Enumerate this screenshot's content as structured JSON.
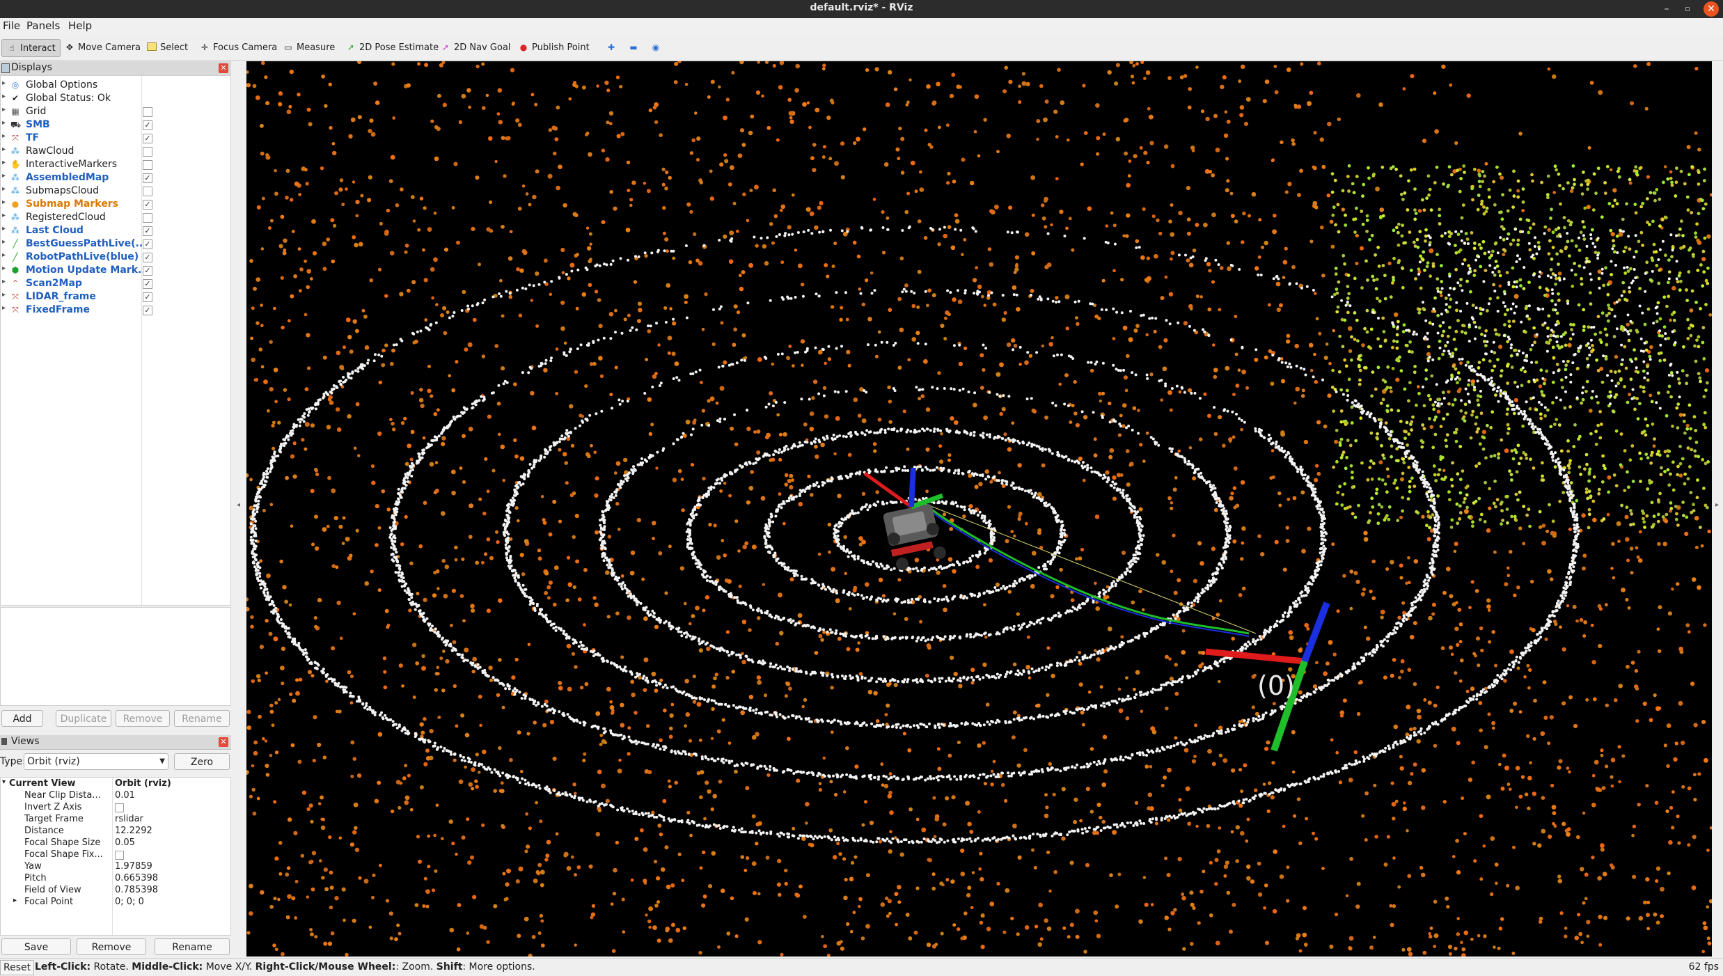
{
  "window": {
    "title": "default.rviz* - RViz"
  },
  "menu": [
    "File",
    "Panels",
    "Help"
  ],
  "toolbar": [
    {
      "label": "Interact",
      "icon": "hand-cursor-icon"
    },
    {
      "label": "Move Camera",
      "icon": "move-camera-icon"
    },
    {
      "label": "Select",
      "icon": "select-box-icon"
    },
    {
      "label": "Focus Camera",
      "icon": "focus-camera-icon"
    },
    {
      "label": "Measure",
      "icon": "ruler-icon"
    },
    {
      "label": "2D Pose Estimate",
      "icon": "green-arrow-icon"
    },
    {
      "label": "2D Nav Goal",
      "icon": "pink-arrow-icon"
    },
    {
      "label": "Publish Point",
      "icon": "map-pin-icon"
    }
  ],
  "displays": {
    "title": "Displays",
    "items": [
      {
        "label": "Global Options",
        "style": "plain",
        "checked": null
      },
      {
        "label": "Global Status: Ok",
        "style": "plain",
        "checked": null
      },
      {
        "label": "Grid",
        "style": "plain",
        "checked": false
      },
      {
        "label": "SMB",
        "style": "blue",
        "checked": true
      },
      {
        "label": "TF",
        "style": "blue",
        "checked": true
      },
      {
        "label": "RawCloud",
        "style": "plain",
        "checked": false
      },
      {
        "label": "InteractiveMarkers",
        "style": "plain",
        "checked": false
      },
      {
        "label": "AssembledMap",
        "style": "blue",
        "checked": true
      },
      {
        "label": "SubmapsCloud",
        "style": "plain",
        "checked": false
      },
      {
        "label": "Submap Markers",
        "style": "orange",
        "checked": true
      },
      {
        "label": "RegisteredCloud",
        "style": "plain",
        "checked": false
      },
      {
        "label": "Last Cloud",
        "style": "blue",
        "checked": true
      },
      {
        "label": "BestGuessPathLive(...",
        "style": "blue",
        "checked": true
      },
      {
        "label": "RobotPathLive(blue)",
        "style": "blue",
        "checked": true
      },
      {
        "label": "Motion Update Mark...",
        "style": "blue",
        "checked": true
      },
      {
        "label": "Scan2Map",
        "style": "blue",
        "checked": true
      },
      {
        "label": "LIDAR_frame",
        "style": "blue",
        "checked": true
      },
      {
        "label": "FixedFrame",
        "style": "blue",
        "checked": true
      }
    ],
    "buttons": {
      "add": "Add",
      "duplicate": "Duplicate",
      "remove": "Remove",
      "rename": "Rename"
    }
  },
  "views": {
    "title": "Views",
    "type_label": "Type:",
    "type_value": "Orbit (rviz)",
    "zero": "Zero",
    "current_view": "Current View",
    "current_view_value": "Orbit (rviz)",
    "props": [
      {
        "key": "Near Clip Dista...",
        "value": "0.01"
      },
      {
        "key": "Invert Z Axis",
        "value": ""
      },
      {
        "key": "Target Frame",
        "value": "rslidar"
      },
      {
        "key": "Distance",
        "value": "12.2292"
      },
      {
        "key": "Focal Shape Size",
        "value": "0.05"
      },
      {
        "key": "Focal Shape Fix...",
        "value": ""
      },
      {
        "key": "Yaw",
        "value": "1.97859"
      },
      {
        "key": "Pitch",
        "value": "0.665398"
      },
      {
        "key": "Field of View",
        "value": "0.785398"
      },
      {
        "key": "Focal Point",
        "value": "0; 0; 0"
      }
    ],
    "buttons": {
      "save": "Save",
      "remove": "Remove",
      "rename": "Rename"
    }
  },
  "viewport": {
    "frame_label": "(0)"
  },
  "status": {
    "reset": "Reset",
    "hint_1_bold": "Left-Click:",
    "hint_1": " Rotate. ",
    "hint_2_bold": "Middle-Click:",
    "hint_2": " Move X/Y. ",
    "hint_3_bold": "Right-Click/Mouse Wheel:",
    "hint_3": ": Zoom. ",
    "hint_4_bold": "Shift",
    "hint_4": ": More options.",
    "fps": "62 fps"
  },
  "colors": {
    "orange_points": "#e8751a",
    "white_points": "#f2f2f2",
    "yellow_points": "#cddc39",
    "axis_red": "#e01b1b",
    "axis_green": "#1fbf2a",
    "axis_blue": "#1a2fe0"
  }
}
